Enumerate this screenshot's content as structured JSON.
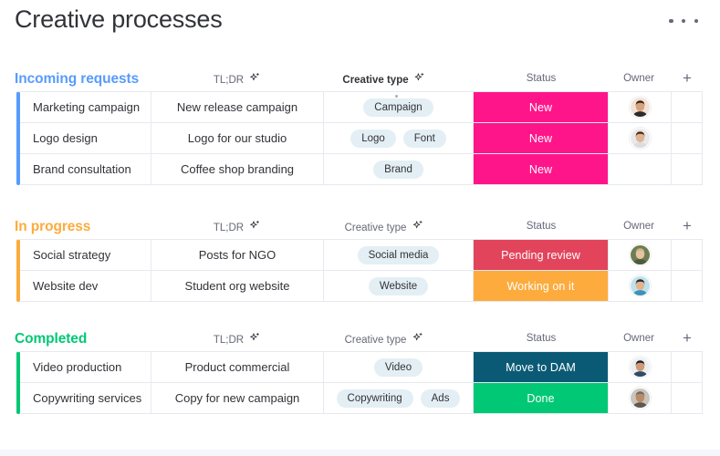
{
  "header": {
    "title": "Creative processes",
    "menu_icon": "kebab-menu-icon"
  },
  "columns": {
    "tldr": "TL;DR",
    "creative_type": "Creative type",
    "status": "Status",
    "owner": "Owner",
    "add": "+",
    "ai_icon": "ai-sparkle-icon"
  },
  "colors": {
    "group_blue": "#579bfc",
    "group_orange": "#fdab3d",
    "group_green": "#00c875",
    "status_new": "#ff158a",
    "status_pending_review": "#e2445c",
    "status_working_on_it": "#fdab3d",
    "status_move_to_dam": "#0b5a75",
    "status_done": "#00c875",
    "chip_bg": "#e3eff4",
    "grid_line": "#e6e9ef",
    "text": "#323338",
    "muted_text": "#676879"
  },
  "groups": [
    {
      "name": "Incoming requests",
      "color": "#579bfc",
      "header_bold_creative_type": true,
      "rows": [
        {
          "name": "Marketing campaign",
          "tldr": "New release campaign",
          "types": [
            "Campaign"
          ],
          "status": "New",
          "status_color": "#ff158a",
          "owner": "avatar-woman-dark-hair"
        },
        {
          "name": "Logo design",
          "tldr": "Logo for our studio",
          "types": [
            "Logo",
            "Font"
          ],
          "status": "New",
          "status_color": "#ff158a",
          "owner": "avatar-woman-long-hair"
        },
        {
          "name": "Brand consultation",
          "tldr": "Coffee shop branding",
          "types": [
            "Brand"
          ],
          "status": "New",
          "status_color": "#ff158a",
          "owner": ""
        }
      ]
    },
    {
      "name": "In progress",
      "color": "#fdab3d",
      "header_bold_creative_type": false,
      "rows": [
        {
          "name": "Social strategy",
          "tldr": "Posts for NGO",
          "types": [
            "Social media"
          ],
          "status": "Pending review",
          "status_color": "#e2445c",
          "owner": "avatar-person-long-hair"
        },
        {
          "name": "Website dev",
          "tldr": "Student org website",
          "types": [
            "Website"
          ],
          "status": "Working on it",
          "status_color": "#fdab3d",
          "owner": "avatar-man-glasses"
        }
      ]
    },
    {
      "name": "Completed",
      "color": "#00c875",
      "header_bold_creative_type": false,
      "rows": [
        {
          "name": "Video production",
          "tldr": "Product commercial",
          "types": [
            "Video"
          ],
          "status": "Move to DAM",
          "status_color": "#0b5a75",
          "owner": "avatar-man-dark-hair"
        },
        {
          "name": "Copywriting services",
          "tldr": "Copy for new campaign",
          "types": [
            "Copywriting",
            "Ads"
          ],
          "status": "Done",
          "status_color": "#00c875",
          "owner": "avatar-man-beard"
        }
      ]
    }
  ]
}
